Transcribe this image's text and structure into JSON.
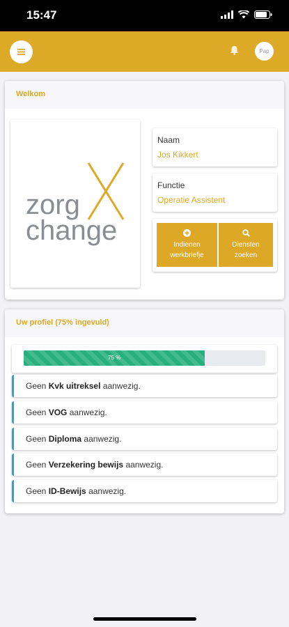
{
  "status_bar": {
    "time": "15:47"
  },
  "header": {
    "menu_icon": "hamburger-icon",
    "bell_icon": "bell-icon",
    "avatar_text": "Pap"
  },
  "welcome": {
    "title": "Welkom",
    "logo_text_line1": "zorg",
    "logo_text_line2": "change",
    "logo_mark": "X",
    "name_label": "Naam",
    "name_value": "Jos Kikkert",
    "function_label": "Functie",
    "function_value": "Operatie Assistent",
    "actions": [
      {
        "icon": "plus-circle-icon",
        "line1": "Indienen",
        "line2": "werkbriefje"
      },
      {
        "icon": "search-icon",
        "line1": "Diensten",
        "line2": "zoeken"
      }
    ]
  },
  "profile": {
    "title": "Uw profiel (75% ingevuld)",
    "progress_percent": 75,
    "progress_label": "75 %",
    "items": [
      {
        "prefix": "Geen",
        "name": "Kvk uitreksel",
        "suffix": "aanwezig."
      },
      {
        "prefix": "Geen",
        "name": "VOG",
        "suffix": "aanwezig."
      },
      {
        "prefix": "Geen",
        "name": "Diploma",
        "suffix": "aanwezig."
      },
      {
        "prefix": "Geen",
        "name": "Verzekering bewijs",
        "suffix": "aanwezig."
      },
      {
        "prefix": "Geen",
        "name": "ID-Bewijs",
        "suffix": "aanwezig."
      }
    ]
  },
  "colors": {
    "brand": "#dcaa26",
    "progress": "#2aae7f",
    "alert_border": "#2aa7c8"
  }
}
